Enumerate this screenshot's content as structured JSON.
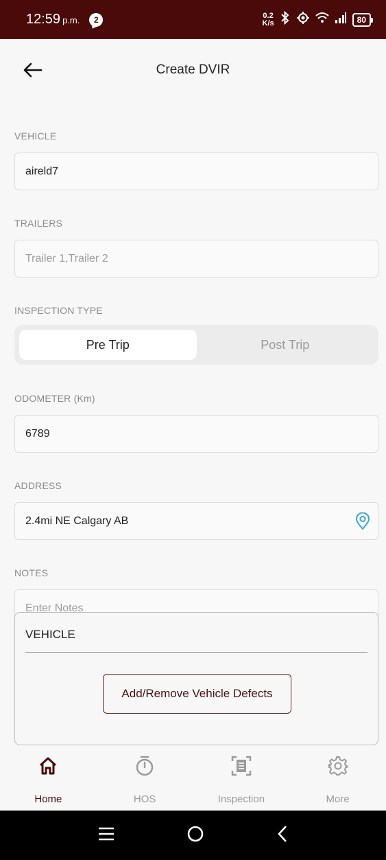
{
  "status_bar": {
    "time": "12:59",
    "ampm": "p.m.",
    "notification_count": "2",
    "net_speed_value": "0.2",
    "net_speed_unit": "K/s",
    "battery": "80"
  },
  "header": {
    "title": "Create DVIR"
  },
  "form": {
    "vehicle": {
      "label": "VEHICLE",
      "value": "aireld7"
    },
    "trailers": {
      "label": "TRAILERS",
      "placeholder": "Trailer 1,Trailer 2"
    },
    "inspection_type": {
      "label": "INSPECTION TYPE",
      "options": [
        "Pre Trip",
        "Post Trip"
      ],
      "selected": "Pre Trip"
    },
    "odometer": {
      "label": "ODOMETER (Km)",
      "value": "6789"
    },
    "address": {
      "label": "ADDRESS",
      "value": "2.4mi NE Calgary AB"
    },
    "notes": {
      "label": "NOTES",
      "placeholder": "Enter Notes"
    }
  },
  "vehicle_card": {
    "title": "VEHICLE",
    "button_label": "Add/Remove Vehicle Defects"
  },
  "bottom_nav": {
    "items": [
      {
        "label": "Home",
        "icon": "home-icon",
        "active": true
      },
      {
        "label": "HOS",
        "icon": "stopwatch-icon",
        "active": false
      },
      {
        "label": "Inspection",
        "icon": "inspection-scan-icon",
        "active": false
      },
      {
        "label": "More",
        "icon": "gear-icon",
        "active": false
      }
    ]
  },
  "colors": {
    "brand": "#4a0a0a",
    "accent_location": "#3aa6d8",
    "inactive": "#9a9a9a"
  }
}
